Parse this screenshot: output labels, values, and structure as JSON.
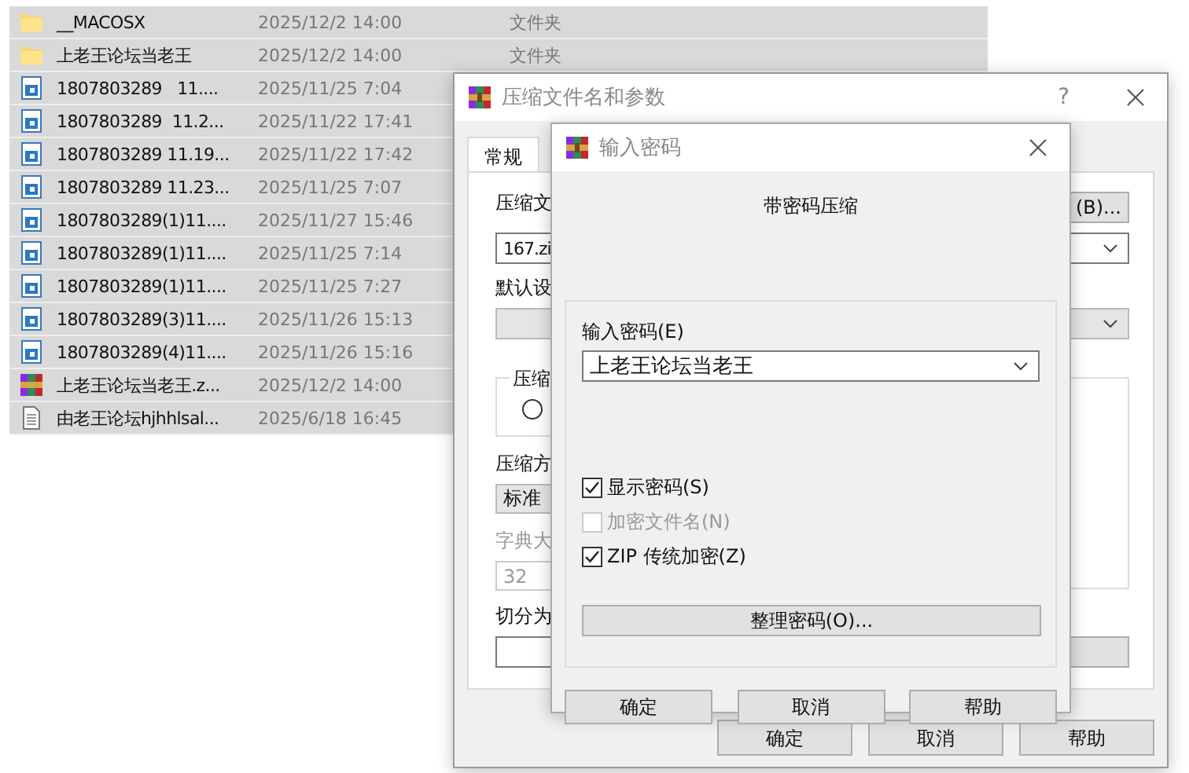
{
  "file_list": {
    "rows": [
      {
        "kind": "folder",
        "name": "__MACOSX",
        "modified": "2025/12/2 14:00",
        "type": "文件夹",
        "selected": true
      },
      {
        "kind": "folder",
        "name": "上老王论坛当老王",
        "modified": "2025/12/2 14:00",
        "type": "文件夹",
        "selected": true
      },
      {
        "kind": "document",
        "name": "1807803289   11....",
        "modified": "2025/11/25 7:04",
        "selected": true
      },
      {
        "kind": "document",
        "name": "1807803289  11.2...",
        "modified": "2025/11/22 17:41",
        "selected": true
      },
      {
        "kind": "document",
        "name": "1807803289 11.19...",
        "modified": "2025/11/22 17:42",
        "selected": true
      },
      {
        "kind": "document",
        "name": "1807803289 11.23...",
        "modified": "2025/11/25 7:07",
        "selected": true
      },
      {
        "kind": "document",
        "name": "1807803289(1)11....",
        "modified": "2025/11/27 15:46",
        "selected": true
      },
      {
        "kind": "document",
        "name": "1807803289(1)11....",
        "modified": "2025/11/25 7:14",
        "selected": true
      },
      {
        "kind": "document",
        "name": "1807803289(1)11....",
        "modified": "2025/11/25 7:27",
        "selected": true
      },
      {
        "kind": "document",
        "name": "1807803289(3)11....",
        "modified": "2025/11/26 15:13",
        "selected": true
      },
      {
        "kind": "document",
        "name": "1807803289(4)11....",
        "modified": "2025/11/26 15:16",
        "selected": true
      },
      {
        "kind": "archive",
        "name": "上老王论坛当老王.z...",
        "modified": "2025/12/2 14:00",
        "selected": true
      },
      {
        "kind": "text",
        "name": "由老王论坛hjhhlsal...",
        "modified": "2025/6/18 16:45",
        "selected": true
      }
    ]
  },
  "archive_dialog": {
    "title": "压缩文件名和参数",
    "help": "?",
    "tabs": [
      {
        "label": "常规",
        "selected": true
      }
    ],
    "archive_name_label": "压缩文",
    "browse_button": "(B)...",
    "archive_name": "167.zi",
    "profile_label": "默认设",
    "method_group_label": "压缩",
    "method_radio_selected": false,
    "method_label": "压缩方",
    "method_value": "标准",
    "dictionary_label": "字典大",
    "dictionary_value": "32",
    "dictionary_disabled": true,
    "split_label": "切分为",
    "buttons": [
      "确定",
      "取消",
      "帮助"
    ]
  },
  "password_dialog": {
    "title": "输入密码",
    "heading": "带密码压缩",
    "password_label": "输入密码(E)",
    "password": "上老王论坛当老王",
    "options": [
      {
        "label": "显示密码(S)",
        "checked": true,
        "disabled": false
      },
      {
        "label": "加密文件名(N)",
        "checked": false,
        "disabled": true
      },
      {
        "label": "ZIP 传统加密(Z)",
        "checked": true,
        "disabled": false
      }
    ],
    "organize_button": "整理密码(O)...",
    "buttons": [
      "确定",
      "取消",
      "帮助"
    ]
  }
}
